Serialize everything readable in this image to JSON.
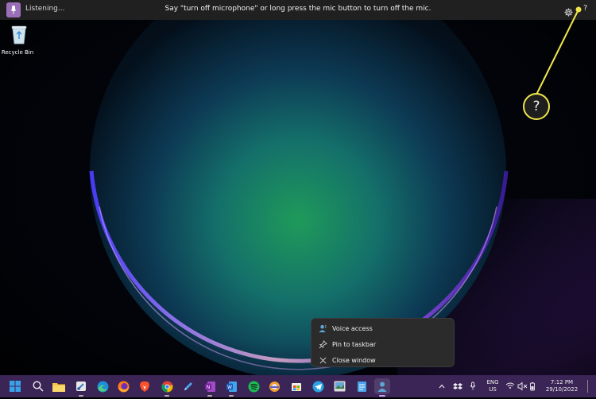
{
  "voice_bar": {
    "status": "Listening...",
    "message": "Say \"turn off microphone\" or long press the mic button to turn off the mic.",
    "help_label": "?"
  },
  "desktop": {
    "recycle_bin_label": "Recycle Bin"
  },
  "callout": {
    "label": "?"
  },
  "context_menu": {
    "items": [
      {
        "label": "Voice access",
        "icon": "voice-access-icon"
      },
      {
        "label": "Pin to taskbar",
        "icon": "pin-icon"
      },
      {
        "label": "Close window",
        "icon": "close-icon"
      }
    ]
  },
  "taskbar": {
    "apps": [
      "Start",
      "Search",
      "File Explorer",
      "Snipping Tool",
      "Edge",
      "Firefox",
      "Brave",
      "Chrome",
      "Pen",
      "OneNote",
      "Word",
      "Spotify",
      "App",
      "Store",
      "Telegram",
      "Photos",
      "Notepad",
      "Voice access"
    ],
    "language": "ENG",
    "region": "US",
    "time": "7:12 PM",
    "date": "29/10/2022"
  },
  "colors": {
    "callout_yellow": "#f0e64a",
    "mic_purple": "#9a6fb8",
    "taskbar": "#3b2456"
  }
}
